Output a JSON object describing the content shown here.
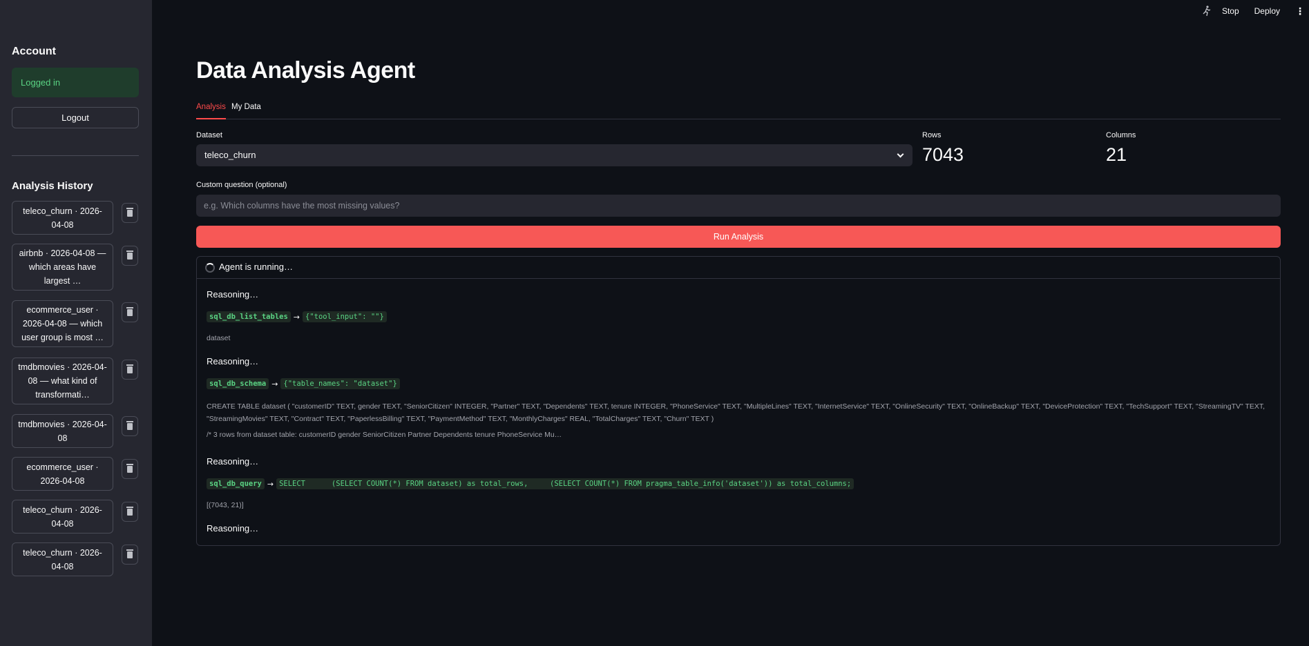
{
  "toolbar": {
    "stop": "Stop",
    "deploy": "Deploy",
    "more": "⋮"
  },
  "sidebar": {
    "account_title": "Account",
    "logged_in": "Logged in",
    "logout": "Logout",
    "history_title": "Analysis History",
    "history": [
      {
        "label": "teleco_churn · 2026-04-08"
      },
      {
        "label": "airbnb · 2026-04-08 — which areas have largest …"
      },
      {
        "label": "ecommerce_user · 2026-04-08 — which user group is most …"
      },
      {
        "label": "tmdbmovies · 2026-04-08 — what kind of transformati…"
      },
      {
        "label": "tmdbmovies · 2026-04-08"
      },
      {
        "label": "ecommerce_user · 2026-04-08"
      },
      {
        "label": "teleco_churn · 2026-04-08"
      },
      {
        "label": "teleco_churn · 2026-04-08"
      }
    ]
  },
  "main": {
    "title": "Data Analysis Agent",
    "tabs": [
      {
        "label": "Analysis"
      },
      {
        "label": "My Data"
      }
    ],
    "dataset_label": "Dataset",
    "dataset_value": "teleco_churn",
    "rows_label": "Rows",
    "rows_value": "7043",
    "columns_label": "Columns",
    "columns_value": "21",
    "question_label": "Custom question (optional)",
    "question_placeholder": "e.g. Which columns have the most missing values?",
    "run_button": "Run Analysis",
    "status": "Agent is running…",
    "log": {
      "reasoning": "Reasoning…",
      "tool1": "sql_db_list_tables",
      "input1": "{\"tool_input\": \"\"}",
      "output1": "dataset",
      "tool2": "sql_db_schema",
      "input2": "{\"table_names\": \"dataset\"}",
      "output2a": "CREATE TABLE dataset ( \"customerID\" TEXT, gender TEXT, \"SeniorCitizen\" INTEGER, \"Partner\" TEXT, \"Dependents\" TEXT, tenure INTEGER, \"PhoneService\" TEXT, \"MultipleLines\" TEXT, \"InternetService\" TEXT, \"OnlineSecurity\" TEXT, \"OnlineBackup\" TEXT, \"DeviceProtection\" TEXT, \"TechSupport\" TEXT, \"StreamingTV\" TEXT, \"StreamingMovies\" TEXT, \"Contract\" TEXT, \"PaperlessBilling\" TEXT, \"PaymentMethod\" TEXT, \"MonthlyCharges\" REAL, \"TotalCharges\" TEXT, \"Churn\" TEXT )",
      "output2b": "/* 3 rows from dataset table: customerID gender SeniorCitizen Partner Dependents tenure PhoneService Mu…",
      "tool3": "sql_db_query",
      "input3": "SELECT      (SELECT COUNT(*) FROM dataset) as total_rows,     (SELECT COUNT(*) FROM pragma_table_info('dataset')) as total_columns;",
      "output3": "[(7043, 21)]"
    }
  }
}
